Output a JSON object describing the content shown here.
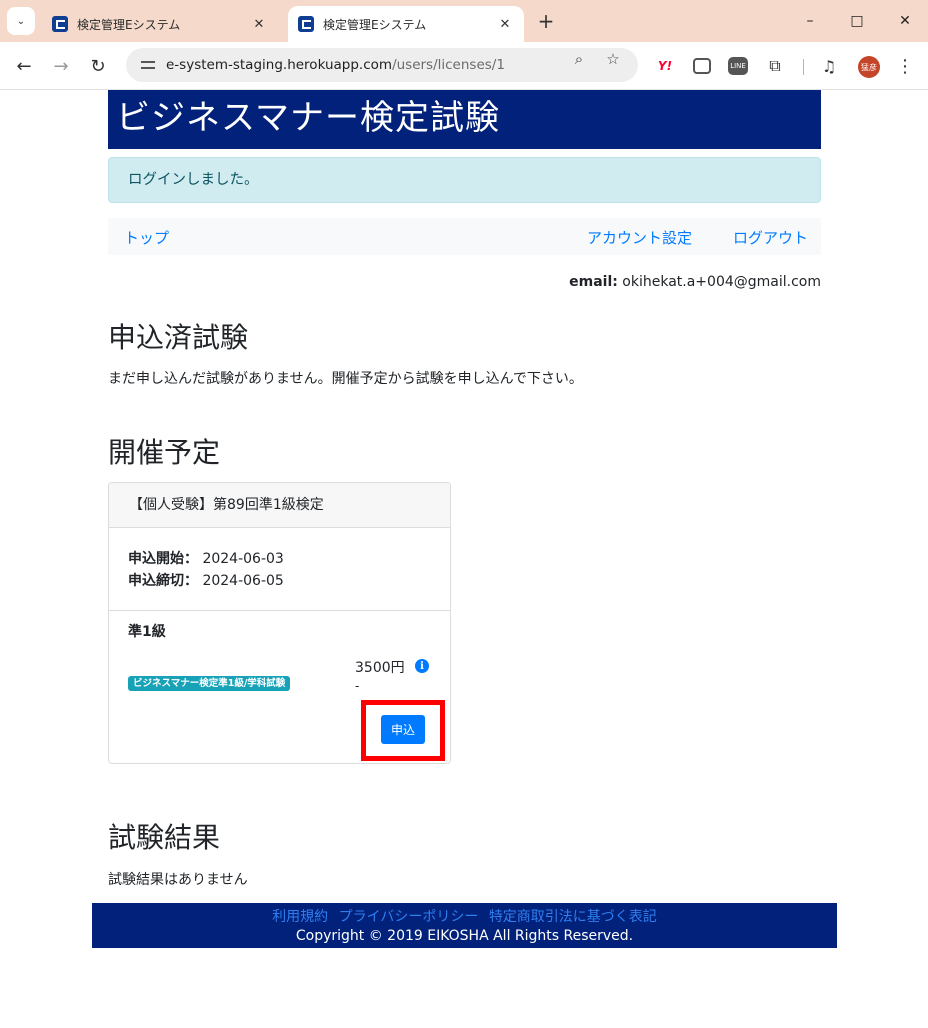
{
  "browser": {
    "tabs": [
      {
        "title": "検定管理Eシステム",
        "active": false
      },
      {
        "title": "検定管理Eシステム",
        "active": true
      }
    ],
    "url_host": "e-system-staging.herokuapp.com",
    "url_path": "/users/licenses/1",
    "avatar_text": "猛彦"
  },
  "header": {
    "title": "ビジネスマナー検定試験"
  },
  "flash": {
    "message": "ログインしました。"
  },
  "nav": {
    "top": "トップ",
    "account": "アカウント設定",
    "logout": "ログアウト"
  },
  "user": {
    "email_label": "email:",
    "email": "okihekat.a+004@gmail.com"
  },
  "applied": {
    "heading": "申込済試験",
    "empty_message": "まだ申し込んだ試験がありません。開催予定から試験を申し込んで下さい。"
  },
  "upcoming": {
    "heading": "開催予定",
    "exams": [
      {
        "title": "【個人受験】第89回準1級検定",
        "start_label": "申込開始：",
        "start_date": "2024-06-03",
        "end_label": "申込締切：",
        "end_date": "2024-06-05",
        "level": "準1級",
        "badge": "ビジネスマナー検定準1級/学科試験",
        "price": "3500円",
        "dash": "-",
        "apply_label": "申込"
      }
    ]
  },
  "results": {
    "heading": "試験結果",
    "empty_message": "試験結果はありません"
  },
  "footer": {
    "links": [
      "利用規約",
      "プライバシーポリシー",
      "特定商取引法に基づく表記"
    ],
    "copyright": "Copyright © 2019 EIKOSHA All Rights Reserved."
  },
  "colors": {
    "brand_navy": "#01217a",
    "link_blue": "#007bff",
    "badge_teal": "#17a2b8",
    "highlight_red": "#ff0000",
    "flash_bg": "#d1ecf1"
  }
}
